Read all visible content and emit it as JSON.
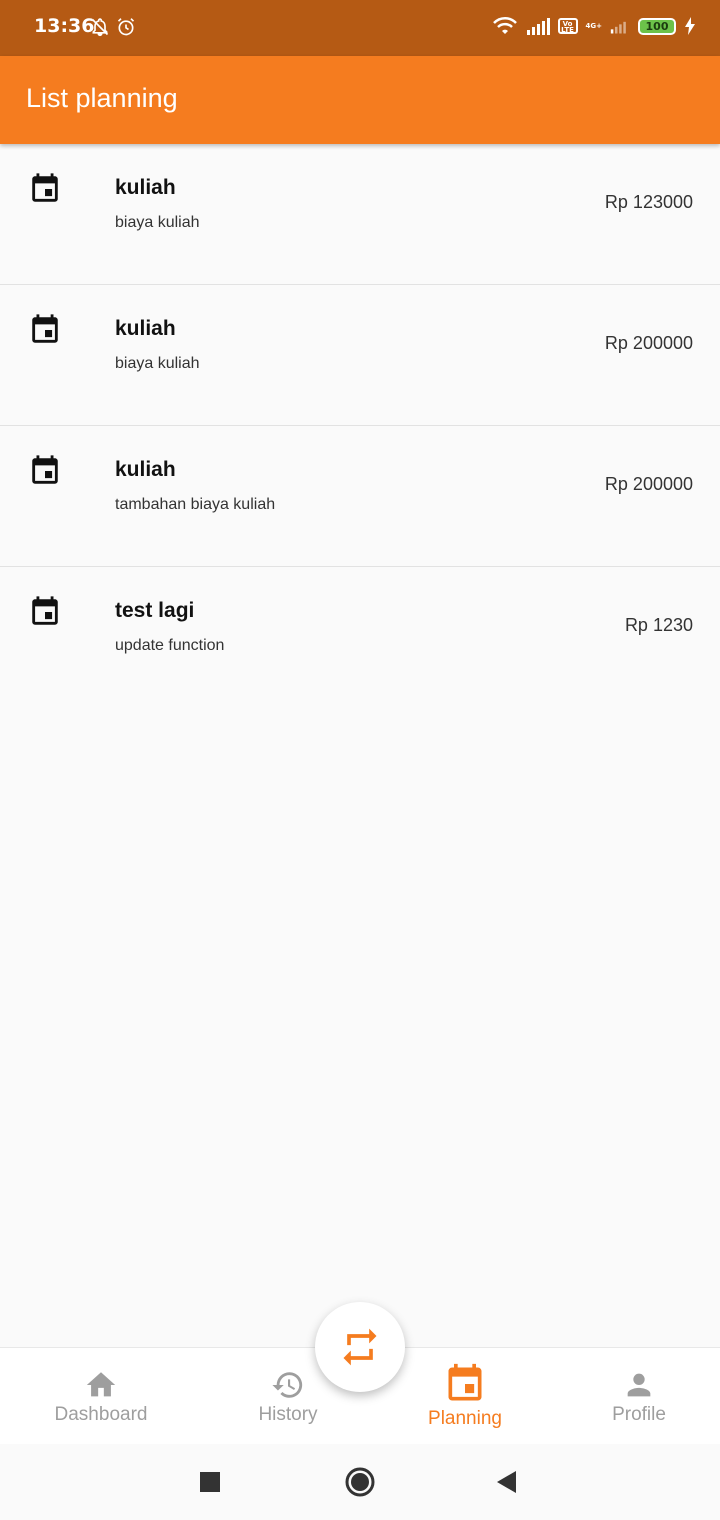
{
  "status_bar": {
    "time": "13:36",
    "battery": "100",
    "volte": "Vo LTE",
    "network_type": "4G+"
  },
  "app_bar": {
    "title": "List planning"
  },
  "plans": [
    {
      "title": "kuliah",
      "description": "biaya kuliah",
      "amount": "Rp 123000",
      "icon": "calendar-icon"
    },
    {
      "title": "kuliah",
      "description": "biaya kuliah",
      "amount": "Rp 200000",
      "icon": "calendar-icon"
    },
    {
      "title": "kuliah",
      "description": "tambahan biaya kuliah",
      "amount": "Rp 200000",
      "icon": "calendar-icon"
    },
    {
      "title": "test lagi",
      "description": "update function",
      "amount": "Rp 1230",
      "icon": "calendar-icon"
    }
  ],
  "fab": {
    "icon": "repeat-icon"
  },
  "bottom_nav": {
    "items": [
      {
        "label": "Dashboard",
        "icon": "home-icon",
        "active": false
      },
      {
        "label": "History",
        "icon": "history-icon",
        "active": false
      },
      {
        "label": "Planning",
        "icon": "calendar-icon",
        "active": true
      },
      {
        "label": "Profile",
        "icon": "person-icon",
        "active": false
      }
    ]
  },
  "colors": {
    "primary": "#f57c1f",
    "status_bar": "#b55a14",
    "inactive": "#9e9e9e",
    "battery": "#6cc24a"
  }
}
